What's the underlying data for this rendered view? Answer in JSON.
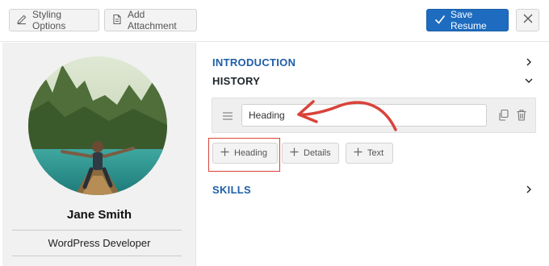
{
  "toolbar": {
    "styling_label": "Styling Options",
    "attach_label": "Add Attachment",
    "save_label": "Save Resume"
  },
  "profile": {
    "name": "Jane Smith",
    "role": "WordPress Developer"
  },
  "sections": {
    "introduction": "INTRODUCTION",
    "history": "HISTORY",
    "skills": "SKILLS"
  },
  "history_item": {
    "heading_value": "Heading"
  },
  "add_buttons": {
    "heading": "Heading",
    "details": "Details",
    "text": "Text"
  },
  "colors": {
    "accent": "#1e6cbf",
    "section_blue": "#1e5ea8",
    "annotation_red": "#d9433a"
  },
  "icons": {
    "styling": "pencil-icon",
    "attach": "document-icon",
    "save": "checkmark-icon",
    "close": "close-icon",
    "drag": "drag-handle-icon",
    "duplicate": "duplicate-icon",
    "delete": "trash-icon",
    "add": "plus-icon"
  }
}
